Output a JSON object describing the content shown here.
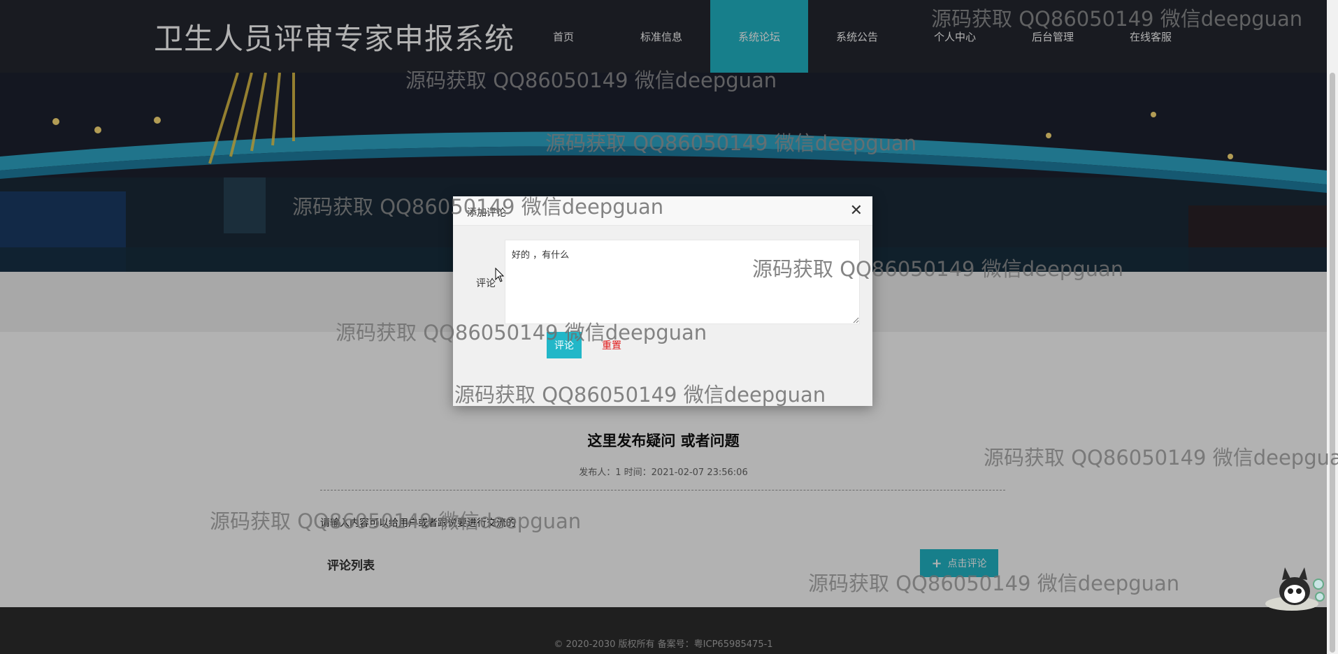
{
  "site": {
    "title": "卫生人员评审专家申报系统"
  },
  "nav": {
    "items": [
      {
        "label": "首页"
      },
      {
        "label": "标准信息"
      },
      {
        "label": "系统论坛"
      },
      {
        "label": "系统公告"
      },
      {
        "label": "个人中心"
      },
      {
        "label": "后台管理"
      },
      {
        "label": "在线客服"
      }
    ],
    "active_index": 2
  },
  "post": {
    "title": "这里发布疑问 或者问题",
    "meta": "发布人：1 时间：2021-02-07 23:56:06",
    "body": "请输入内容可以给用户或者跟说要进行交流的",
    "comments_title": "评论列表",
    "comment_button_label": "点击评论"
  },
  "modal": {
    "title": "添加评论",
    "close_icon": "close-icon",
    "field_label": "评论",
    "textarea_value": "好的 ，有什么",
    "submit_label": "评论",
    "reset_label": "重置"
  },
  "footer": {
    "text": "© 2020-2030 版权所有 备案号：粤ICP65985475-1"
  },
  "watermark": {
    "text": "源码获取 QQ86050149 微信deepguan"
  },
  "colors": {
    "header_bg": "#252830",
    "accent": "#22b7c8",
    "reset_text": "#e01a1a",
    "footer_bg": "#2d2d2d"
  }
}
